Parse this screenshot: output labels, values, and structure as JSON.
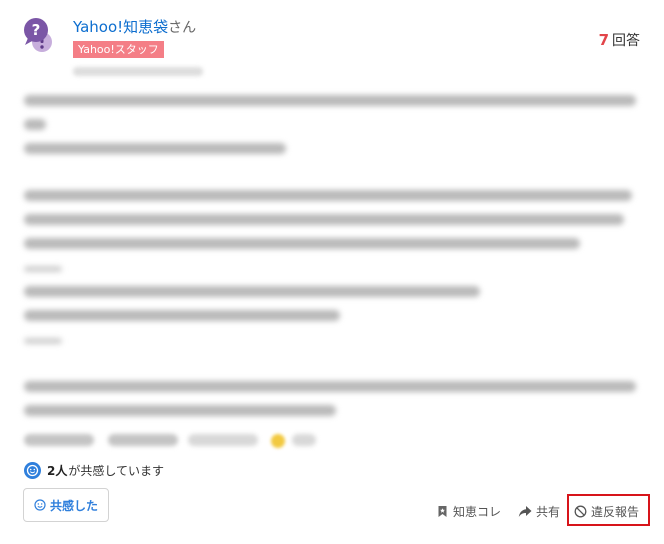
{
  "answer": {
    "user": {
      "name": "Yahoo!知恵袋",
      "honorific": "さん",
      "badge": "Yahoo!スタッフ"
    },
    "answer_count": {
      "number": "7",
      "label": "回答"
    },
    "empathy": {
      "count": "2人",
      "text": "が共感しています",
      "button_label": "共感した"
    },
    "actions": {
      "save_label": "知恵コレ",
      "share_label": "共有",
      "report_label": "違反報告"
    }
  },
  "colors": {
    "link": "#0d6ecf",
    "badge": "#f47e86",
    "accent": "#2f7fdc",
    "answer_count_number": "#e2454a",
    "highlight_border": "#d7141a"
  }
}
